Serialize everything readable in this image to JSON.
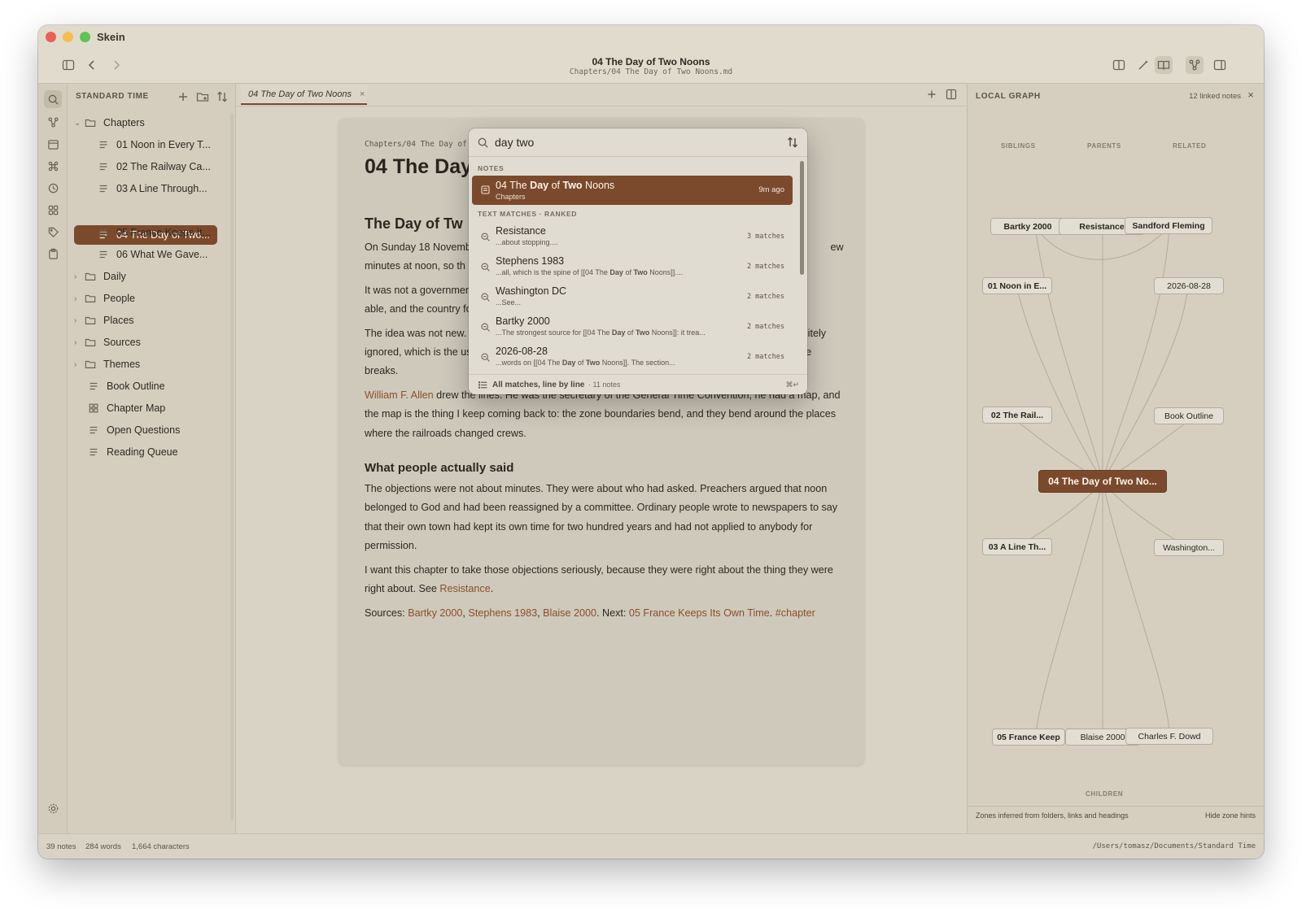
{
  "app": {
    "name": "Skein"
  },
  "window": {
    "title": "04 The Day of Two Noons",
    "subtitle": "Chapters/04 The Day of Two Noons.md"
  },
  "sidebar": {
    "heading": "STANDARD TIME",
    "items": [
      {
        "label": "Chapters",
        "type": "folder",
        "expanded": true
      },
      {
        "label": "01 Noon in Every T...",
        "type": "note"
      },
      {
        "label": "02 The Railway Ca...",
        "type": "note"
      },
      {
        "label": "03 A Line Through...",
        "type": "note"
      },
      {
        "label": "04 The Day of Two...",
        "type": "note",
        "selected": true
      },
      {
        "label": "05 France Keeps It...",
        "type": "note"
      },
      {
        "label": "06 What We Gave...",
        "type": "note"
      },
      {
        "label": "Daily",
        "type": "folder"
      },
      {
        "label": "People",
        "type": "folder"
      },
      {
        "label": "Places",
        "type": "folder"
      },
      {
        "label": "Sources",
        "type": "folder"
      },
      {
        "label": "Themes",
        "type": "folder"
      },
      {
        "label": "Book Outline",
        "type": "note"
      },
      {
        "label": "Chapter Map",
        "type": "grid"
      },
      {
        "label": "Open Questions",
        "type": "note"
      },
      {
        "label": "Reading Queue",
        "type": "note"
      }
    ]
  },
  "tab": {
    "label": "04 The Day of Two Noons",
    "close": "×"
  },
  "document": {
    "path": "Chapters/04 The Day of",
    "title": "04 The Day",
    "heading": "The Day of Tw",
    "p1": "On Sunday 18 Novemb                                         heir own time and started k                                          ew minutes at noon, so th                                          it was.",
    "p2": "It was not a governmen                                           rty-five years. It was a trad                                        able, and the country follow",
    "p3_a": "The idea was not new.",
    "p3_b": "en",
    "p3_c": "politely ignored, which is the useful part: an idea does not win on merit, it wins when somebody's timetable breaks.",
    "p4_link": "William F. Allen",
    "p4": " drew the lines. He was the secretary of the General Time Convention, he had a map, and the map is the thing I keep coming back to: the zone boundaries bend, and they bend around the places where the railroads changed crews.",
    "h3": "What people actually said",
    "p5": "The objections were not about minutes. They were about who had asked. Preachers argued that noon belonged to God and had been reassigned by a committee. Ordinary people wrote to newspapers to say that their own town had kept its own time for two hundred years and had not applied to anybody for permission.",
    "p6": "I want this chapter to take those objections seriously, because they were right about the thing they were right about. See ",
    "p6_link": "Resistance",
    "p6_end": ".",
    "sources_label": "Sources: ",
    "src1": "Bartky 2000",
    "src2": "Stephens 1983",
    "src3": "Blaise 2000",
    "next_label": ". Next: ",
    "next": "05 France Keeps Its Own Time",
    "tag": "#chapter",
    "comma": ", ",
    "dot": ". "
  },
  "palette": {
    "query": "day two",
    "notes_heading": "NOTES",
    "top_hit": {
      "title_pre": "04 The ",
      "title_b1": "Day",
      "title_mid": " of ",
      "title_b2": "Two",
      "title_post": " Noons",
      "subtitle": "Chapters",
      "meta": "9m ago"
    },
    "matches_heading": "TEXT MATCHES · RANKED",
    "matches": [
      {
        "title": "Resistance",
        "snippet": "...about stopping....",
        "count": "3 matches"
      },
      {
        "title": "Stephens 1983",
        "snippet_pre": "...all, which is the spine of [[04 The ",
        "b1": "Day",
        "mid": " of ",
        "b2": "Two",
        "snippet_post": " Noons]]....",
        "count": "2 matches"
      },
      {
        "title": "Washington DC",
        "snippet": "...See...",
        "count": "2 matches"
      },
      {
        "title": "Bartky 2000",
        "snippet_pre": "...The strongest source for [[04 The ",
        "b1": "Day",
        "mid": " of ",
        "b2": "Two",
        "snippet_post": " Noons]]: it trea...",
        "count": "2 matches"
      },
      {
        "title": "2026-08-28",
        "snippet_pre": "...words on [[04 The ",
        "b1": "Day",
        "mid": " of ",
        "b2": "Two",
        "snippet_post": " Noons]]. The section...",
        "count": "2 matches"
      }
    ],
    "footer_label": "All matches, line by line",
    "footer_count": "· 11 notes",
    "footer_key": "⌘↵"
  },
  "graph": {
    "heading": "LOCAL GRAPH",
    "count": "12 linked notes",
    "zones": {
      "siblings": "SIBLINGS",
      "parents": "PARENTS",
      "related": "RELATED",
      "children": "CHILDREN"
    },
    "nodes": {
      "bartky": "Bartky 2000",
      "resistance": "Resistance",
      "sandford": "Sandford Fleming",
      "n01": "01 Noon in E...",
      "date": "2026-08-28",
      "n02": "02 The Rail...",
      "outline": "Book Outline",
      "center": "04 The Day of Two No...",
      "n03": "03 A Line Th...",
      "washington": "Washington...",
      "n05": "05 France Keep",
      "blaise": "Blaise 2000",
      "dowd": "Charles F. Dowd"
    },
    "footer_left": "Zones inferred from folders, links and headings",
    "footer_right": "Hide zone hints"
  },
  "status": {
    "notes": "39 notes",
    "words": "284 words",
    "chars": "1,664 characters",
    "path": "/Users/tomasz/Documents/Standard Time"
  },
  "colors": {
    "accent": "#7b4a2c",
    "background": "#d9d3c5",
    "link": "#8a4f2c"
  }
}
